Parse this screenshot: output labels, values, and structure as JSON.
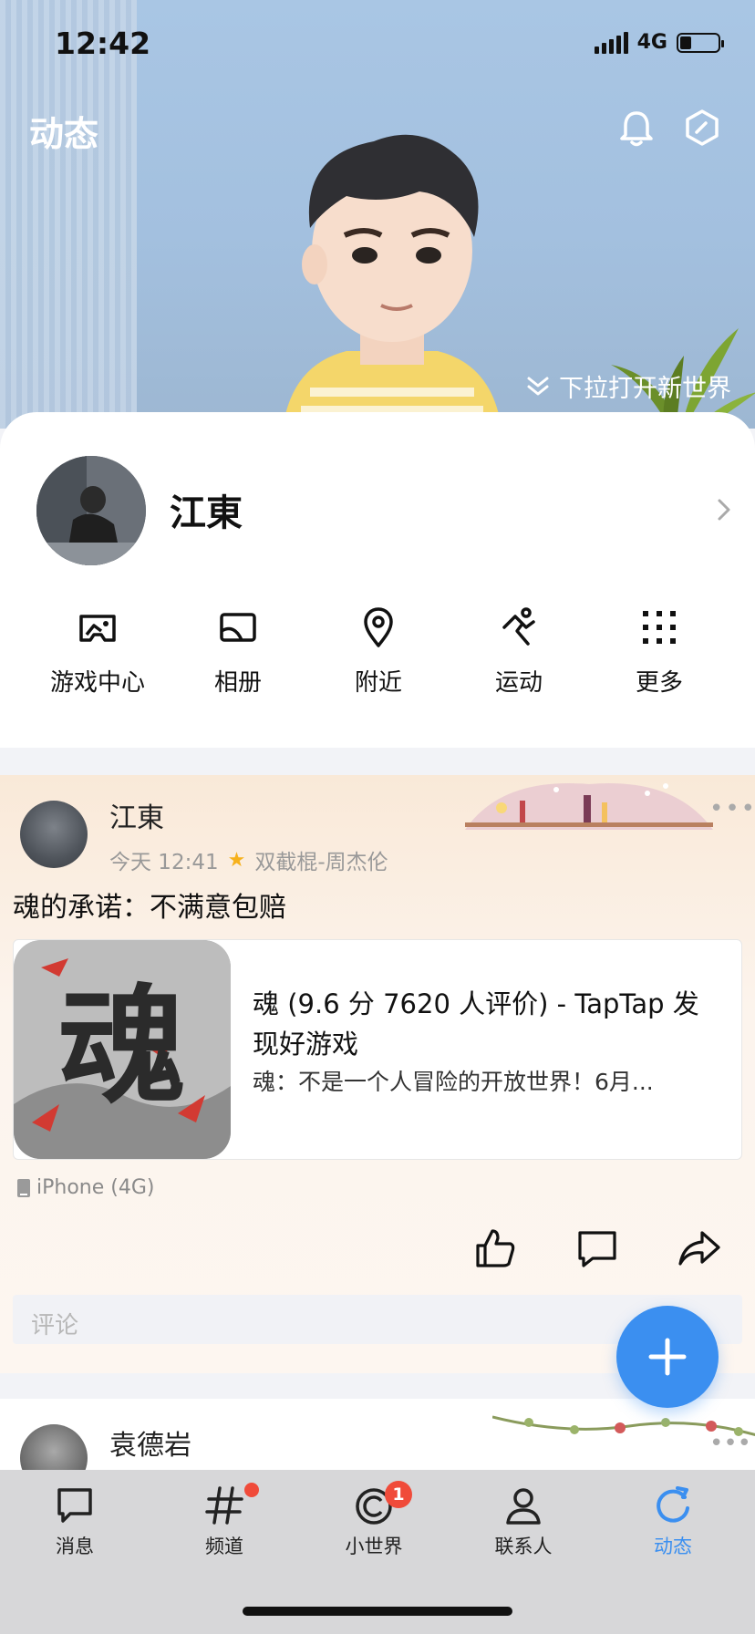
{
  "status_bar": {
    "time": "12:42",
    "network": "4G"
  },
  "header": {
    "title": "动态",
    "pull_hint": "下拉打开新世界"
  },
  "profile": {
    "name": "江東",
    "quick_actions": [
      {
        "label": "游戏中心",
        "icon": "gamepad-icon"
      },
      {
        "label": "相册",
        "icon": "photo-album-icon"
      },
      {
        "label": "附近",
        "icon": "location-pin-icon"
      },
      {
        "label": "运动",
        "icon": "running-icon"
      },
      {
        "label": "更多",
        "icon": "grid-dots-icon"
      }
    ]
  },
  "feed": {
    "post1": {
      "author": "江東",
      "time": "今天 12:41",
      "song": "双截棍-周杰伦",
      "text": "魂的承诺：不满意包赔",
      "share": {
        "title": "魂 (9.6 分 7620 人评价) - TapTap 发现好游戏",
        "description": "魂：不是一个人冒险的开放世界！6月...",
        "thumb_glyph": "魂"
      },
      "device": "iPhone (4G)",
      "comment_placeholder": "评论"
    },
    "post2": {
      "author": "袁德岩"
    }
  },
  "tabs": [
    {
      "label": "消息",
      "icon": "message-icon"
    },
    {
      "label": "频道",
      "icon": "hashtag-icon"
    },
    {
      "label": "小世界",
      "icon": "small-world-icon",
      "badge": "1"
    },
    {
      "label": "联系人",
      "icon": "contact-icon"
    },
    {
      "label": "动态",
      "icon": "feed-refresh-icon",
      "active": true
    }
  ],
  "colors": {
    "accent": "#3b8ff0",
    "badge": "#f04b3a",
    "banner_sky": "#a9c6e4",
    "post_bg": "#fcf4ed"
  }
}
